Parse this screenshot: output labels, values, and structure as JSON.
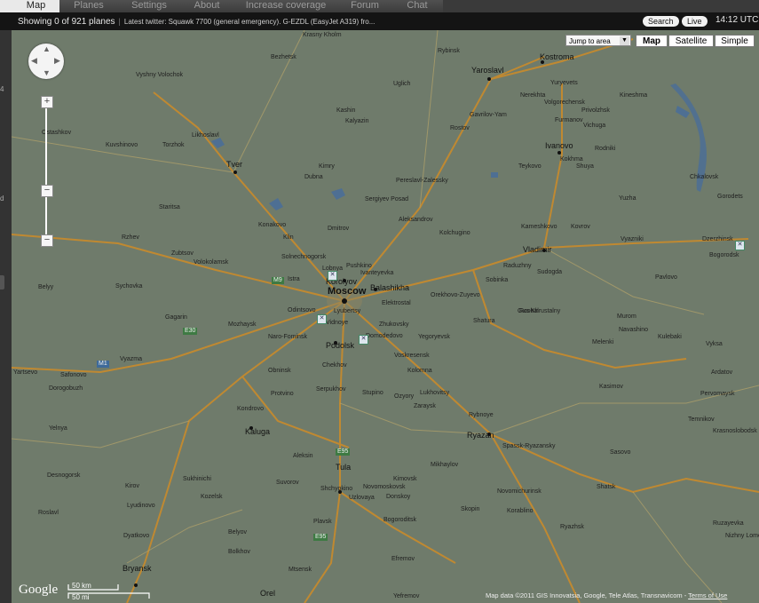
{
  "tabs": [
    {
      "label": "Map",
      "active": true
    },
    {
      "label": "Planes",
      "active": false
    },
    {
      "label": "Settings",
      "active": false
    },
    {
      "label": "About",
      "active": false
    },
    {
      "label": "Increase coverage",
      "active": false
    },
    {
      "label": "Forum",
      "active": false
    },
    {
      "label": "Chat",
      "active": false
    }
  ],
  "status": {
    "planes": "Showing 0 of 921 planes",
    "twitter": "Latest twitter: Squawk 7700 (general emergency). G-EZDL (EasyJet A319) fro...",
    "search_label": "Search",
    "live_label": "Live",
    "time": "14:12 UTC"
  },
  "left_marks": [
    "4",
    "d"
  ],
  "map_controls": {
    "jump_label": "Jump to area",
    "map_label": "Map",
    "satellite_label": "Satellite",
    "simple_label": "Simple",
    "zoom_in": "+",
    "zoom_out": "−",
    "zoom_mid": "−"
  },
  "cities": [
    {
      "name": "Moscow",
      "size": "huge"
    },
    {
      "name": "Tver",
      "size": "big"
    },
    {
      "name": "Yaroslavl",
      "size": "big"
    },
    {
      "name": "Kostroma",
      "size": "big"
    },
    {
      "name": "Ivanovo",
      "size": "big"
    },
    {
      "name": "Vladimir",
      "size": "big"
    },
    {
      "name": "Ryazan",
      "size": "big"
    },
    {
      "name": "Tula",
      "size": "big"
    },
    {
      "name": "Kaluga",
      "size": "big"
    },
    {
      "name": "Bryansk",
      "size": "big"
    },
    {
      "name": "Orel",
      "size": "big"
    },
    {
      "name": "Podolsk",
      "size": "big"
    },
    {
      "name": "Korolyov",
      "size": "big"
    },
    {
      "name": "Balashikha",
      "size": "big"
    },
    {
      "name": "Krasny Kholm",
      "size": ""
    },
    {
      "name": "Bezhetsk",
      "size": ""
    },
    {
      "name": "Vyshny Volochok",
      "size": ""
    },
    {
      "name": "Kashin",
      "size": ""
    },
    {
      "name": "Uglich",
      "size": ""
    },
    {
      "name": "Rybinsk",
      "size": ""
    },
    {
      "name": "Kalyazin",
      "size": ""
    },
    {
      "name": "Ostashkov",
      "size": ""
    },
    {
      "name": "Kuvshinovo",
      "size": ""
    },
    {
      "name": "Torzhok",
      "size": ""
    },
    {
      "name": "Likhoslavl",
      "size": ""
    },
    {
      "name": "Kimry",
      "size": ""
    },
    {
      "name": "Dubna",
      "size": ""
    },
    {
      "name": "Rostov",
      "size": ""
    },
    {
      "name": "Gavrilov-Yam",
      "size": ""
    },
    {
      "name": "Pereslavl-Zalessky",
      "size": ""
    },
    {
      "name": "Yuryevets",
      "size": ""
    },
    {
      "name": "Nerekhta",
      "size": ""
    },
    {
      "name": "Volgorechensk",
      "size": ""
    },
    {
      "name": "Kineshma",
      "size": ""
    },
    {
      "name": "Privolzhsk",
      "size": ""
    },
    {
      "name": "Furmanov",
      "size": ""
    },
    {
      "name": "Vichuga",
      "size": ""
    },
    {
      "name": "Rodniki",
      "size": ""
    },
    {
      "name": "Teykovo",
      "size": ""
    },
    {
      "name": "Kokhma",
      "size": ""
    },
    {
      "name": "Shuya",
      "size": ""
    },
    {
      "name": "Chkalovsk",
      "size": ""
    },
    {
      "name": "Gorodets",
      "size": ""
    },
    {
      "name": "Yuzha",
      "size": ""
    },
    {
      "name": "Staritsa",
      "size": ""
    },
    {
      "name": "Konakovo",
      "size": ""
    },
    {
      "name": "Sergiyev Posad",
      "size": ""
    },
    {
      "name": "Aleksandrov",
      "size": ""
    },
    {
      "name": "Kolchugino",
      "size": ""
    },
    {
      "name": "Kameshkovo",
      "size": ""
    },
    {
      "name": "Kovrov",
      "size": ""
    },
    {
      "name": "Vyazniki",
      "size": ""
    },
    {
      "name": "Dzerzhinsk",
      "size": ""
    },
    {
      "name": "Bogorodsk",
      "size": ""
    },
    {
      "name": "Rzhev",
      "size": ""
    },
    {
      "name": "Zubtsov",
      "size": ""
    },
    {
      "name": "Klin",
      "size": ""
    },
    {
      "name": "Dmitrov",
      "size": ""
    },
    {
      "name": "Volokolamsk",
      "size": ""
    },
    {
      "name": "Solnechnogorsk",
      "size": ""
    },
    {
      "name": "Lobnya",
      "size": ""
    },
    {
      "name": "Pushkino",
      "size": ""
    },
    {
      "name": "Ivanteyevka",
      "size": ""
    },
    {
      "name": "Raduzhny",
      "size": ""
    },
    {
      "name": "Sudogda",
      "size": ""
    },
    {
      "name": "Gus-Khrustalny",
      "size": ""
    },
    {
      "name": "Pavlovo",
      "size": ""
    },
    {
      "name": "Sobinka",
      "size": ""
    },
    {
      "name": "Istra",
      "size": ""
    },
    {
      "name": "Belyy",
      "size": ""
    },
    {
      "name": "Sychovka",
      "size": ""
    },
    {
      "name": "Orekhovo-Zuyevo",
      "size": ""
    },
    {
      "name": "Elektrostal",
      "size": ""
    },
    {
      "name": "Lyubertsy",
      "size": ""
    },
    {
      "name": "Odintsovo",
      "size": ""
    },
    {
      "name": "Vidnoye",
      "size": ""
    },
    {
      "name": "Zhukovsky",
      "size": ""
    },
    {
      "name": "Domodedovo",
      "size": ""
    },
    {
      "name": "Roshal",
      "size": ""
    },
    {
      "name": "Shatura",
      "size": ""
    },
    {
      "name": "Murom",
      "size": ""
    },
    {
      "name": "Navashino",
      "size": ""
    },
    {
      "name": "Kulebaki",
      "size": ""
    },
    {
      "name": "Vyksa",
      "size": ""
    },
    {
      "name": "Melenki",
      "size": ""
    },
    {
      "name": "Gagarin",
      "size": ""
    },
    {
      "name": "Mozhaysk",
      "size": ""
    },
    {
      "name": "Naro-Fominsk",
      "size": ""
    },
    {
      "name": "Yegoryevsk",
      "size": ""
    },
    {
      "name": "Voskresensk",
      "size": ""
    },
    {
      "name": "Vyazma",
      "size": ""
    },
    {
      "name": "Yartsevo",
      "size": ""
    },
    {
      "name": "Safonovo",
      "size": ""
    },
    {
      "name": "Dorogobuzh",
      "size": ""
    },
    {
      "name": "Obninsk",
      "size": ""
    },
    {
      "name": "Chekhov",
      "size": ""
    },
    {
      "name": "Kolomna",
      "size": ""
    },
    {
      "name": "Serpukhov",
      "size": ""
    },
    {
      "name": "Protvino",
      "size": ""
    },
    {
      "name": "Stupino",
      "size": ""
    },
    {
      "name": "Ozyory",
      "size": ""
    },
    {
      "name": "Lukhovitsy",
      "size": ""
    },
    {
      "name": "Zaraysk",
      "size": ""
    },
    {
      "name": "Kasimov",
      "size": ""
    },
    {
      "name": "Sasovo",
      "size": ""
    },
    {
      "name": "Pervomaysk",
      "size": ""
    },
    {
      "name": "Ardatov",
      "size": ""
    },
    {
      "name": "Temnikov",
      "size": ""
    },
    {
      "name": "Krasnoslobodsk",
      "size": ""
    },
    {
      "name": "Kondrovo",
      "size": ""
    },
    {
      "name": "Rybnoye",
      "size": ""
    },
    {
      "name": "Spassk-Ryazansky",
      "size": ""
    },
    {
      "name": "Yelnya",
      "size": ""
    },
    {
      "name": "Desnogorsk",
      "size": ""
    },
    {
      "name": "Roslavl",
      "size": ""
    },
    {
      "name": "Kirov",
      "size": ""
    },
    {
      "name": "Lyudinovo",
      "size": ""
    },
    {
      "name": "Dyatkovo",
      "size": ""
    },
    {
      "name": "Sukhinichi",
      "size": ""
    },
    {
      "name": "Kozelsk",
      "size": ""
    },
    {
      "name": "Suvorov",
      "size": ""
    },
    {
      "name": "Aleksin",
      "size": ""
    },
    {
      "name": "Shchyokino",
      "size": ""
    },
    {
      "name": "Uzlovaya",
      "size": ""
    },
    {
      "name": "Novomoskovsk",
      "size": ""
    },
    {
      "name": "Donskoy",
      "size": ""
    },
    {
      "name": "Kimovsk",
      "size": ""
    },
    {
      "name": "Mikhaylov",
      "size": ""
    },
    {
      "name": "Shatsk",
      "size": ""
    },
    {
      "name": "Novomichurinsk",
      "size": ""
    },
    {
      "name": "Skopin",
      "size": ""
    },
    {
      "name": "Korablino",
      "size": ""
    },
    {
      "name": "Ryazhsk",
      "size": ""
    },
    {
      "name": "Bogoroditsk",
      "size": ""
    },
    {
      "name": "Efremov",
      "size": ""
    },
    {
      "name": "Plavsk",
      "size": ""
    },
    {
      "name": "Belyov",
      "size": ""
    },
    {
      "name": "Bolkhov",
      "size": ""
    },
    {
      "name": "Mtsensk",
      "size": ""
    },
    {
      "name": "Yefremov",
      "size": ""
    },
    {
      "name": "Ruzayevka",
      "size": ""
    },
    {
      "name": "Nizhny Lomov",
      "size": ""
    }
  ],
  "road_labels": [
    "M9",
    "E30",
    "M1",
    "E95",
    "E95"
  ],
  "bottom": {
    "google": "Google",
    "scale_km": "50 km",
    "scale_mi": "50 mi",
    "attribution": "Map data ©2011 GIS Innovatsia, Google, Tele Atlas, Transnavicom -",
    "terms": "Terms of Use"
  }
}
